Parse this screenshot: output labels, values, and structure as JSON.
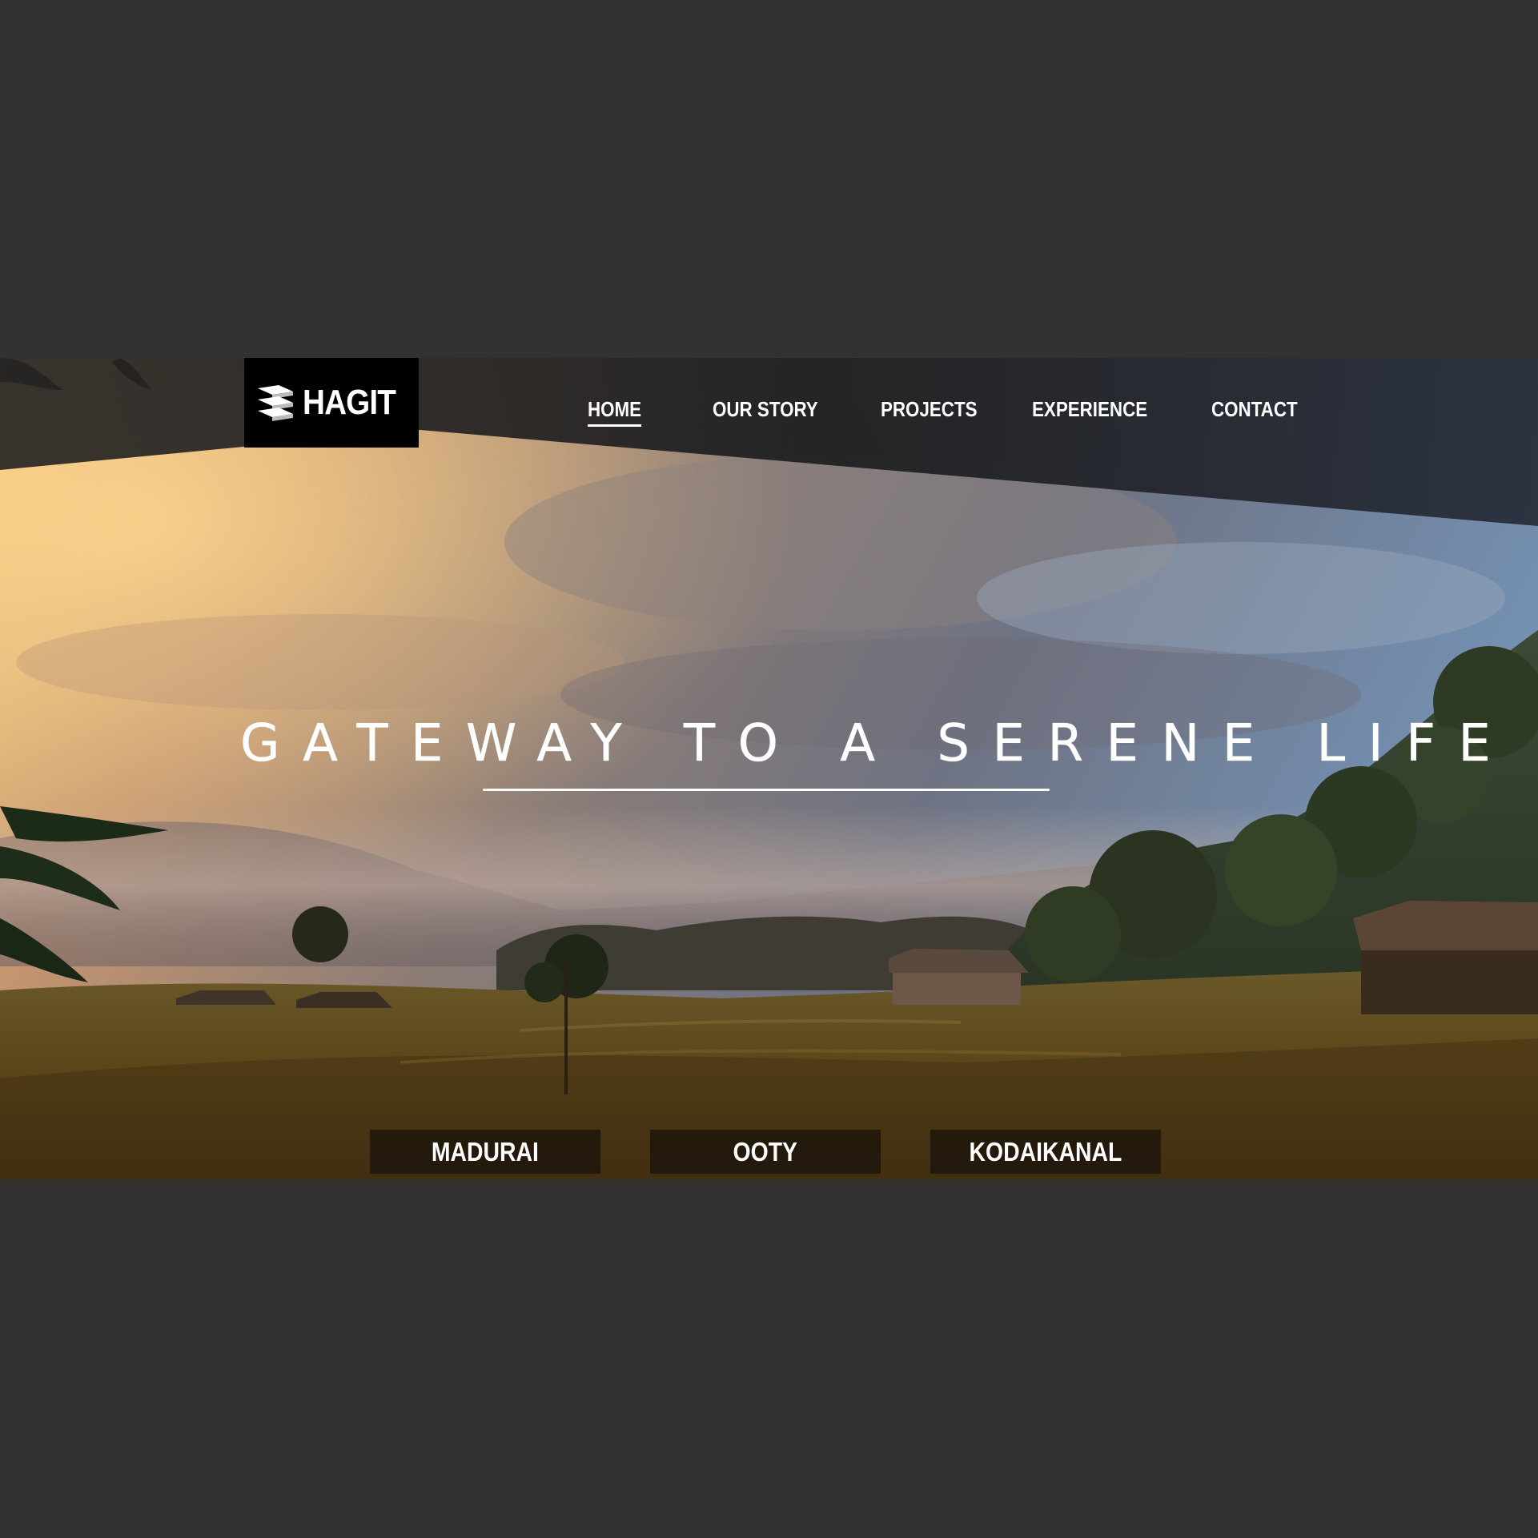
{
  "brand": {
    "name": "HAGIT",
    "logo_icon": "stacked-layers-icon"
  },
  "nav": {
    "items": [
      {
        "label": "HOME",
        "active": true
      },
      {
        "label": "OUR STORY",
        "active": false
      },
      {
        "label": "PROJECTS",
        "active": false
      },
      {
        "label": "EXPERIENCE",
        "active": false
      },
      {
        "label": "CONTACT",
        "active": false
      }
    ]
  },
  "hero": {
    "tagline": "GATEWAY TO A SERENE LIFE",
    "image": "misty-valley-village-sunrise"
  },
  "destinations": [
    {
      "label": "MADURAI"
    },
    {
      "label": "OOTY"
    },
    {
      "label": "KODAIKANAL"
    }
  ],
  "colors": {
    "page_background": "#333132",
    "nav_band": "#1e1e20",
    "logo_background": "#000000",
    "text": "#ffffff"
  }
}
